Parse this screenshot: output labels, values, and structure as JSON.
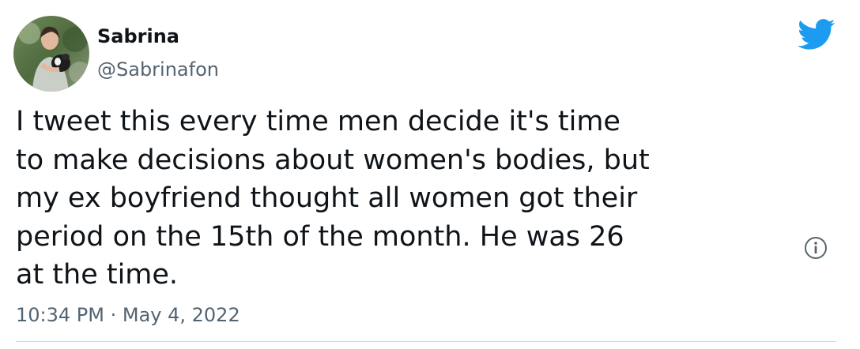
{
  "author": {
    "display_name": "Sabrina",
    "handle": "@Sabrinafon"
  },
  "tweet": {
    "text_lines": [
      "I tweet this every time men decide it's time",
      "to make decisions about women's bodies, but",
      "my ex boyfriend thought all women got their",
      "period on the 15th of the month. He was 26",
      "at the time."
    ],
    "timestamp": "10:34 PM · May 4, 2022"
  },
  "icons": {
    "avatar": "profile-photo",
    "brand": "twitter-bird-icon",
    "info": "info-icon"
  },
  "colors": {
    "brand_blue": "#1d9bf0",
    "text_primary": "#0f1419",
    "text_secondary": "#536471",
    "divider": "#cfd9de"
  }
}
